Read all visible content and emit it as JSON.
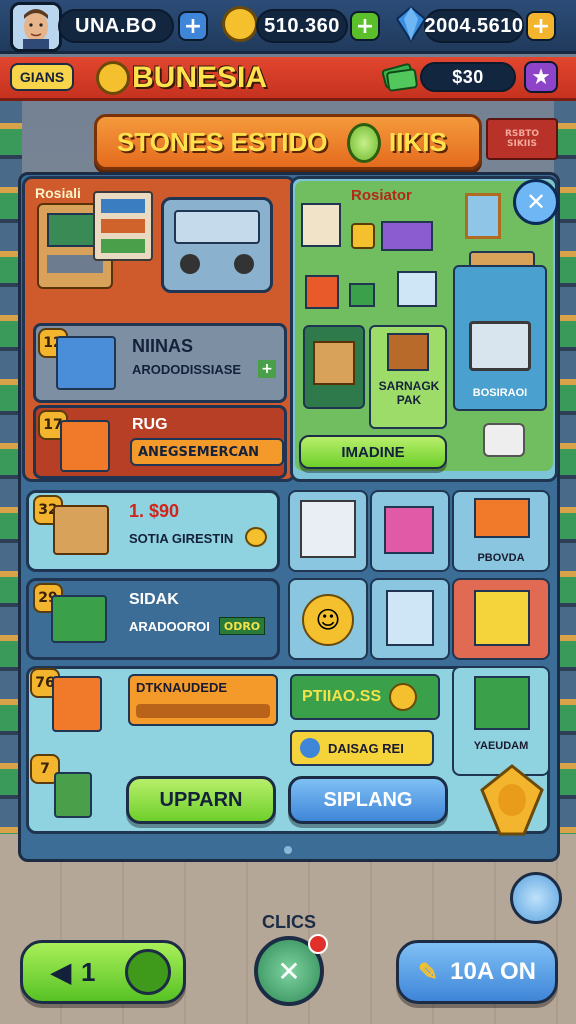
{
  "top": {
    "player_name": "UNA.BO",
    "coins": "510.360",
    "gems": "2004.5610"
  },
  "sub": {
    "left_tag": "GIANS",
    "shop_name": "BUNESIA",
    "cash": "$30"
  },
  "banner": {
    "title": "STONES ESTIDO",
    "title_tail": "IIKIS",
    "side_sign": "RSBTO SIKIIS"
  },
  "store": {
    "section_title": "Rosiali",
    "right_title": "Rosiator",
    "rows": [
      {
        "level": "12",
        "title": "NIINAS",
        "subtitle": "ARODODISSIASE"
      },
      {
        "level": "17",
        "title": "RUG",
        "subtitle": "ANEGSEMERCAN"
      }
    ],
    "mid_item_label": "SARNAGK PAK",
    "pc_label": "BOSIRAOI",
    "buy_button": "IMADINE"
  },
  "list": [
    {
      "level": "32",
      "title": "1. $90",
      "subtitle": "SOTIA GIRESTIN"
    },
    {
      "level": "29",
      "title": "SIDAK",
      "subtitle": "ARADOOROI",
      "tag": "ODRO"
    },
    {
      "level": "76",
      "title": "DTKNAUDEDE",
      "progress": 0.0
    },
    {
      "level": "7",
      "title": ""
    }
  ],
  "right_labels": {
    "box_label": "PBOVDA",
    "cart_label": "YAEUDAM",
    "price_label": "PTIIAO.SS",
    "dais_label": "DAISAG REI"
  },
  "actions": {
    "upgrade": "UPPARN",
    "shipping": "SIPLANG"
  },
  "bottom": {
    "back_value": "1",
    "center_label": "CLICS",
    "right_label": "10A ON"
  },
  "colors": {
    "accent": "#f4b52e",
    "green": "#6fcf2b",
    "blue": "#3f86d8",
    "red": "#d9402a"
  }
}
